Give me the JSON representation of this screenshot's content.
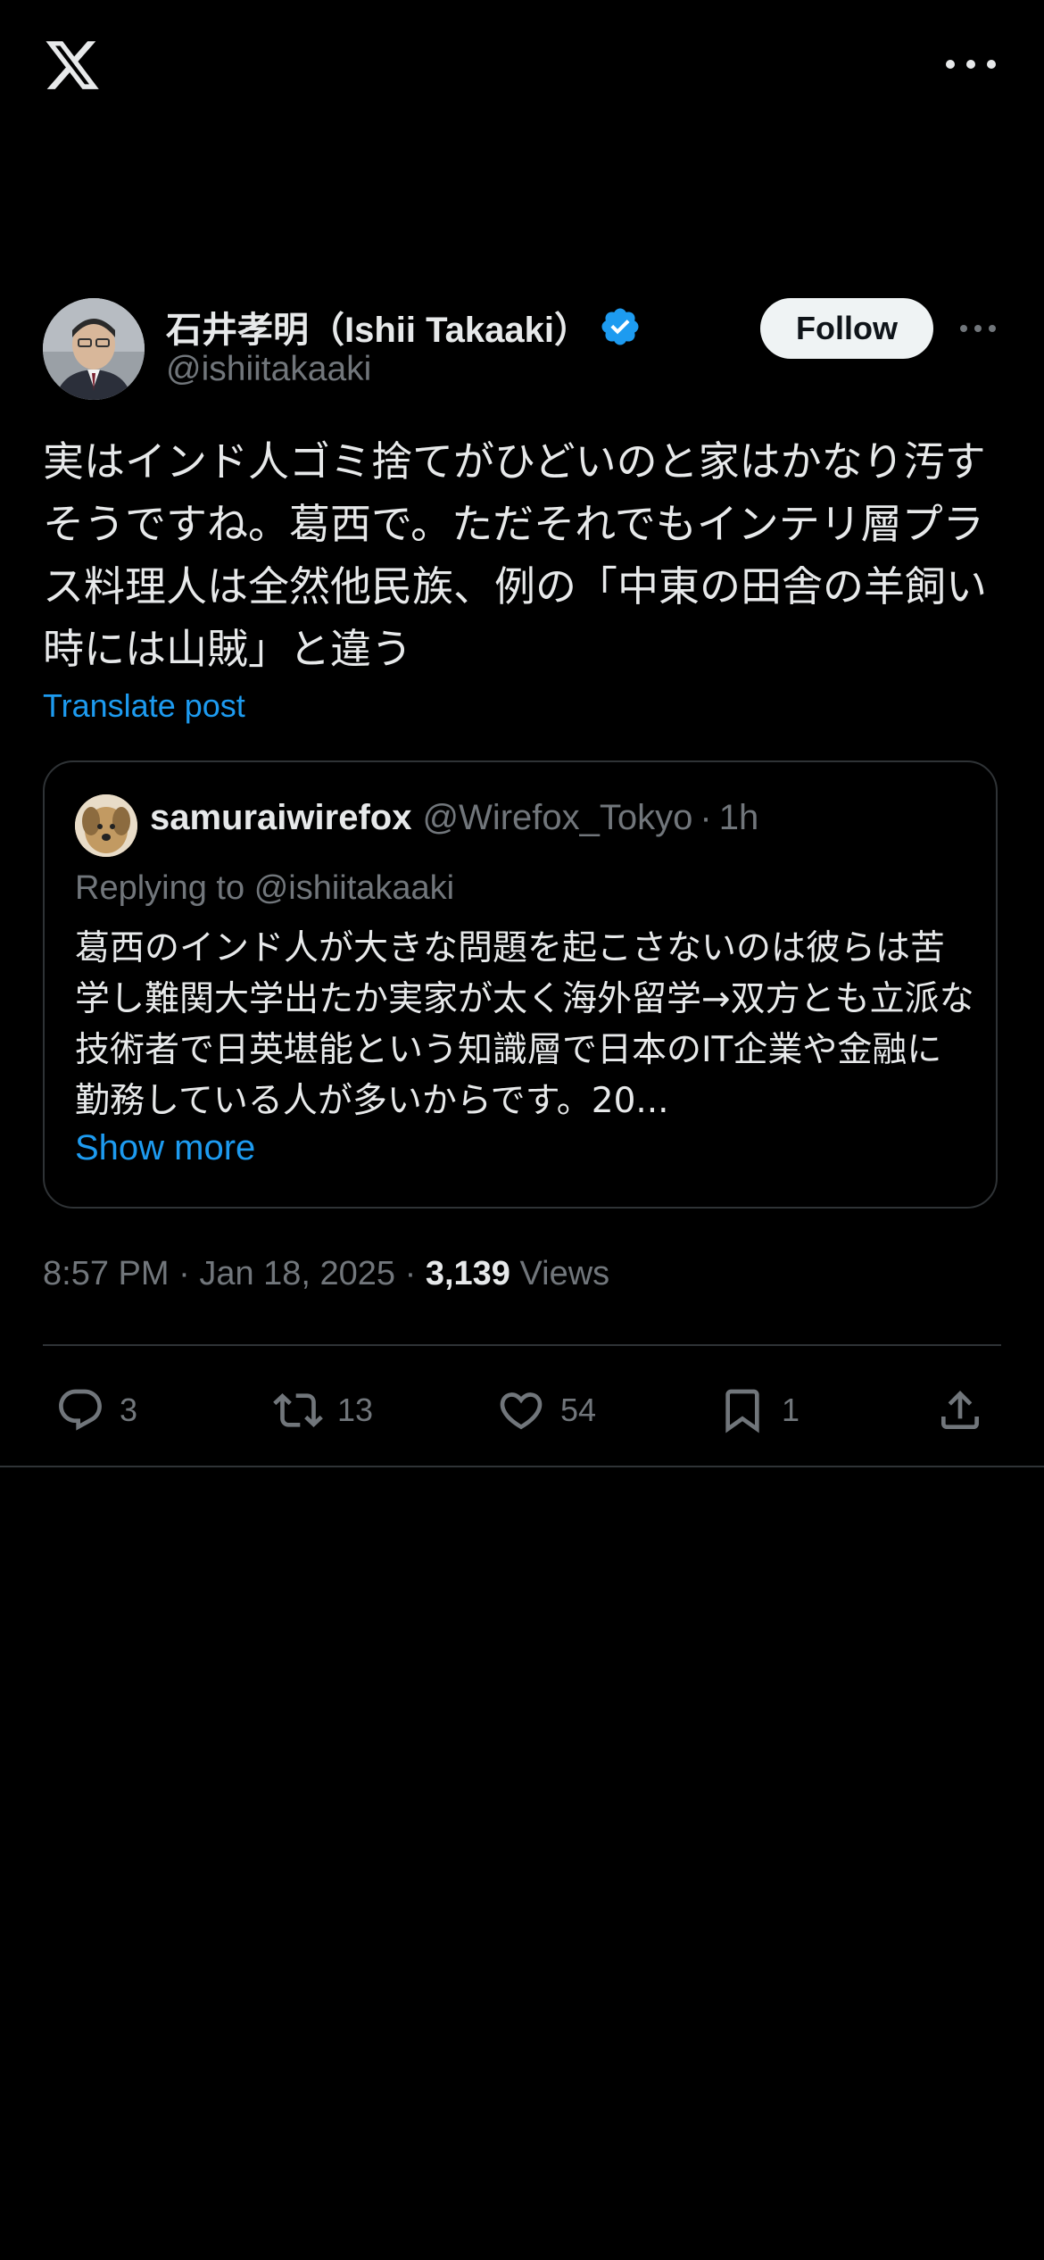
{
  "topbar": {
    "logo_icon": "x-logo-icon",
    "more_icon": "more-horizontal-icon"
  },
  "post": {
    "author": {
      "name": "石井孝明（Ishii Takaaki）",
      "handle": "@ishiitakaaki",
      "verified": true,
      "verified_color": "#1d9bf0"
    },
    "follow_label": "Follow",
    "text": "実はインド人ゴミ捨てがひどいのと家はかなり汚すそうですね。葛西で。ただそれでもインテリ層プラス料理人は全然他民族、例の「中東の田舎の羊飼い時には山賊」と違う",
    "translate_label": "Translate post",
    "quoted": {
      "name": "samuraiwirefox",
      "handle": "@Wirefox_Tokyo",
      "separator": "·",
      "time": "1h",
      "replying_prefix": "Replying to",
      "replying_to": "@ishiitakaaki",
      "text": "葛西のインド人が大きな問題を起こさないのは彼らは苦学し難関大学出たか実家が太く海外留学→双方とも立派な技術者で日英堪能という知識層で日本のIT企業や金融に勤務している人が多いからです。20...",
      "show_more_label": "Show more"
    },
    "meta": {
      "time": "8:57 PM",
      "separator": "·",
      "date": "Jan 18, 2025",
      "views_count": "3,139",
      "views_label": "Views"
    },
    "actions": {
      "replies": "3",
      "reposts": "13",
      "likes": "54",
      "bookmarks": "1"
    }
  },
  "colors": {
    "background": "#000000",
    "text": "#e7e9ea",
    "secondary": "#71767b",
    "accent": "#1d9bf0",
    "border": "#2f3336"
  }
}
